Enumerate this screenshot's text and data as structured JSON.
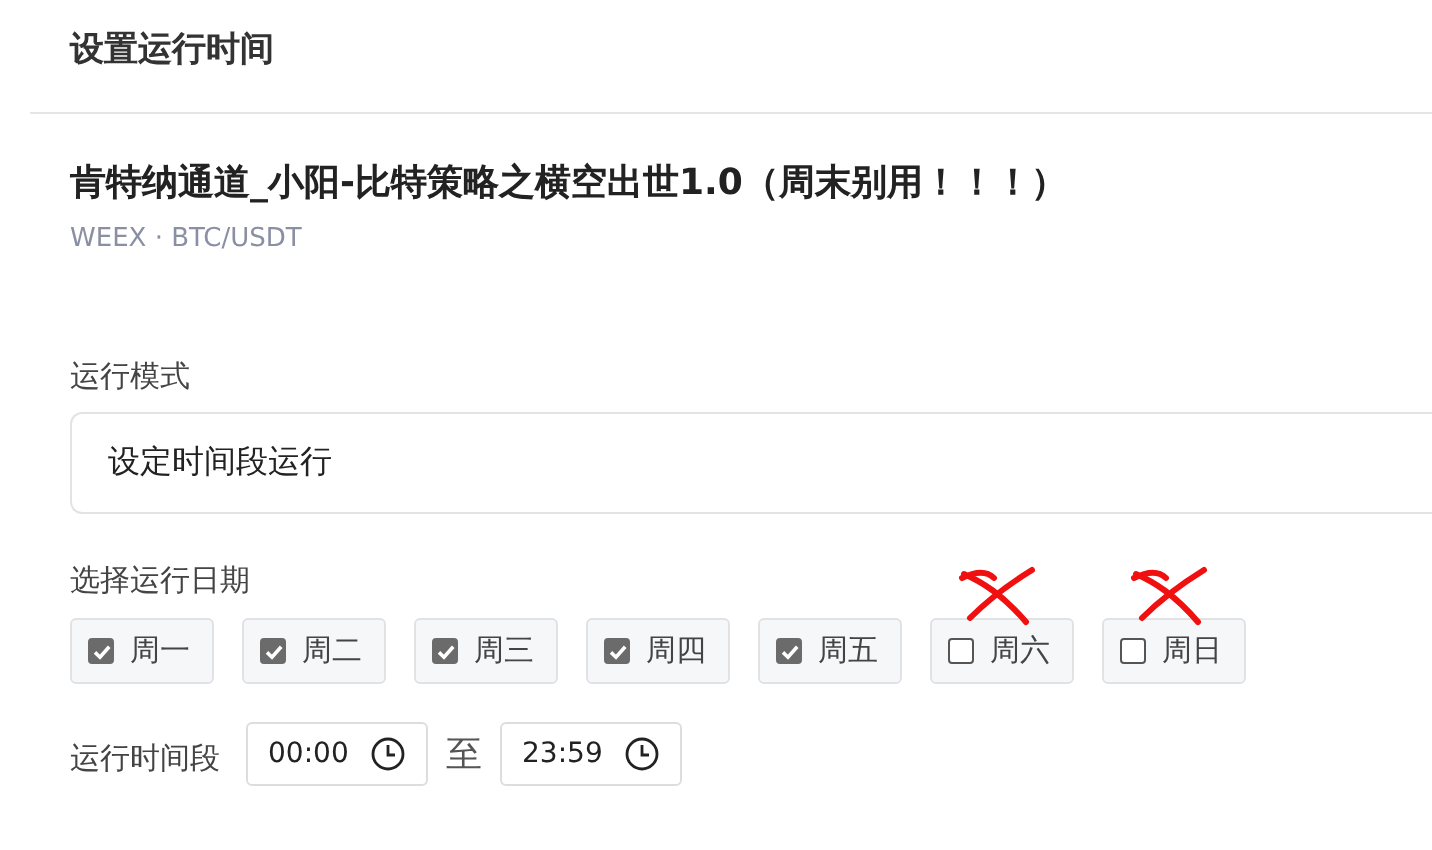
{
  "dialog": {
    "title": "设置运行时间"
  },
  "strategy": {
    "name": "肯特纳通道_小阳-比特策略之横空出世1.0（周末别用！！！）",
    "market": "WEEX · BTC/USDT"
  },
  "mode": {
    "label": "运行模式",
    "value": "设定时间段运行"
  },
  "days": {
    "label": "选择运行日期",
    "items": [
      {
        "label": "周一",
        "checked": true,
        "crossed_out": false
      },
      {
        "label": "周二",
        "checked": true,
        "crossed_out": false
      },
      {
        "label": "周三",
        "checked": true,
        "crossed_out": false
      },
      {
        "label": "周四",
        "checked": true,
        "crossed_out": false
      },
      {
        "label": "周五",
        "checked": true,
        "crossed_out": false
      },
      {
        "label": "周六",
        "checked": false,
        "crossed_out": true
      },
      {
        "label": "周日",
        "checked": false,
        "crossed_out": true
      }
    ]
  },
  "time_range": {
    "label": "运行时间段",
    "start": "00:00",
    "separator": "至",
    "end": "23:59"
  }
}
